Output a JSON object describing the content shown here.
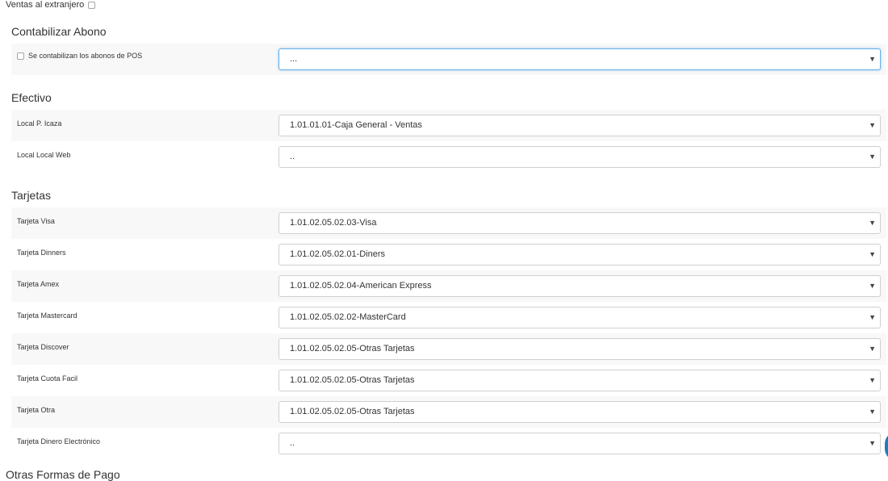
{
  "top": {
    "foreign_sales_label": "Ventas al extranjero"
  },
  "sections": {
    "abono": {
      "title": "Contabilizar Abono",
      "checkbox_label": "Se contabilizan los abonos de POS",
      "select_value": "..."
    },
    "efectivo": {
      "title": "Efectivo",
      "rows": [
        {
          "label": "Local P. Icaza",
          "value": "1.01.01.01-Caja General - Ventas"
        },
        {
          "label": "Local Local Web",
          "value": ".."
        }
      ]
    },
    "tarjetas": {
      "title": "Tarjetas",
      "rows": [
        {
          "label": "Tarjeta Visa",
          "value": "1.01.02.05.02.03-Visa"
        },
        {
          "label": "Tarjeta Dinners",
          "value": "1.01.02.05.02.01-Diners"
        },
        {
          "label": "Tarjeta Amex",
          "value": "1.01.02.05.02.04-American Express"
        },
        {
          "label": "Tarjeta Mastercard",
          "value": "1.01.02.05.02.02-MasterCard"
        },
        {
          "label": "Tarjeta Discover",
          "value": "1.01.02.05.02.05-Otras Tarjetas"
        },
        {
          "label": "Tarjeta Cuota Facil",
          "value": "1.01.02.05.02.05-Otras Tarjetas"
        },
        {
          "label": "Tarjeta Otra",
          "value": "1.01.02.05.02.05-Otras Tarjetas"
        },
        {
          "label": "Tarjeta Dinero Electrónico",
          "value": ".."
        }
      ]
    },
    "otras": {
      "title": "Otras Formas de Pago"
    }
  },
  "icons": {
    "select_arrow": "▼"
  },
  "colors": {
    "focus_border": "#66afe9",
    "row_shade": "#f8f8f8",
    "floating_button": "#1e7bc0"
  }
}
